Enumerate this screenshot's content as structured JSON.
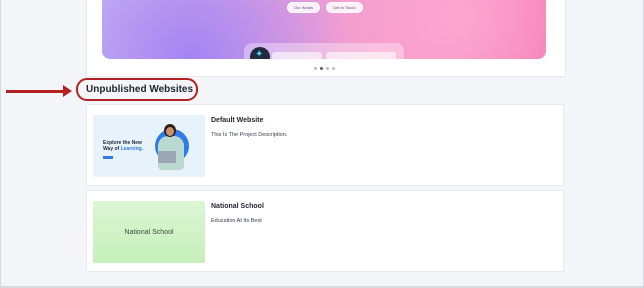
{
  "carousel": {
    "hero_buttons": [
      "Our Works",
      "Get In Touch"
    ],
    "dots": [
      false,
      true,
      false,
      false
    ]
  },
  "section": {
    "title": "Unpublished Websites"
  },
  "websites": [
    {
      "name": "Default Website",
      "description": "This Is The Project Description.",
      "thumb": {
        "tiny": "",
        "headline_1": "Explore the New",
        "headline_2": "Way of ",
        "headline_highlight": "Learning."
      }
    },
    {
      "name": "National School",
      "description": "Education At Its Best",
      "thumb": {
        "label": "National School"
      }
    }
  ],
  "colors": {
    "highlight_annotation": "#b22222",
    "accent_blue": "#2f7be8"
  }
}
